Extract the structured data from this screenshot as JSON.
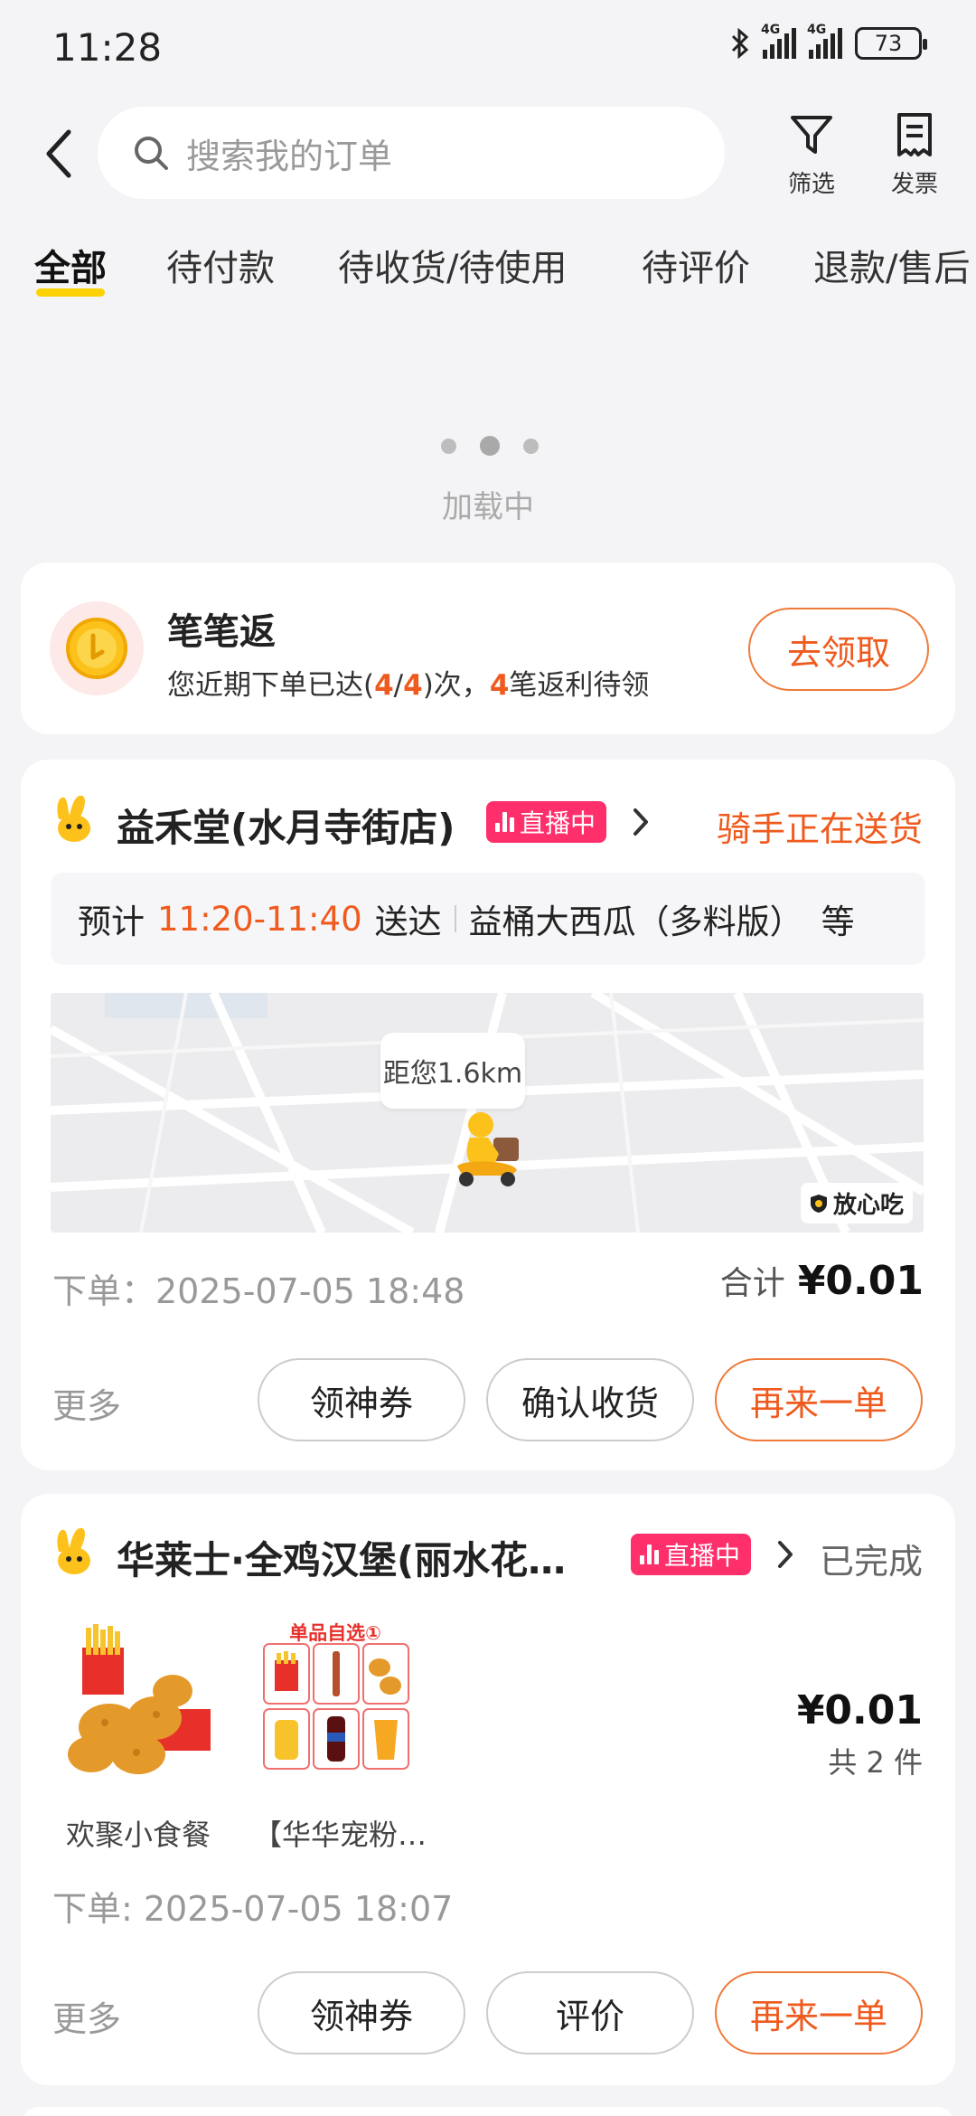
{
  "status_bar": {
    "time": "11:28",
    "battery": "73",
    "net1": "4G",
    "net2": "4G"
  },
  "header": {
    "search_placeholder": "搜索我的订单",
    "filter_label": "筛选",
    "invoice_label": "发票"
  },
  "tabs": [
    {
      "label": "全部",
      "active": true
    },
    {
      "label": "待付款"
    },
    {
      "label": "待收货/待使用"
    },
    {
      "label": "待评价"
    },
    {
      "label": "退款/售后"
    }
  ],
  "loading": {
    "text": "加载中"
  },
  "rebate": {
    "title": "笔笔返",
    "desc_pre": "您近期下单已达(",
    "count_done": "4",
    "slash": "/",
    "count_total": "4",
    "desc_mid": ")次，",
    "count_pending": "4",
    "desc_post": "笔返利待领",
    "button": "去领取"
  },
  "orders": [
    {
      "store": "益禾堂(水月寺街店)",
      "live_badge": "直播中",
      "status": "骑手正在送货",
      "eta_prefix": "预计",
      "eta_time": "11:20-11:40",
      "eta_suffix": "送达",
      "items_summary": "益桶大西瓜（多料版）",
      "items_more": "等",
      "distance": "距您1.6km",
      "trust_badge": "放心吃",
      "order_time": "下单：2025-07-05 18:48",
      "total_label": "合计",
      "total": "¥0.01",
      "more": "更多",
      "buttons": [
        "领神券",
        "确认收货",
        "再来一单"
      ]
    },
    {
      "store": "华莱士·全鸡汉堡(丽水花…",
      "live_badge": "直播中",
      "status": "已完成",
      "items": [
        {
          "name": "欢聚小食餐"
        },
        {
          "name": "【华华宠粉…",
          "overlay": "单品自选①"
        }
      ],
      "price": "¥0.01",
      "count": "共 2 件",
      "order_time": "下单: 2025-07-05 18:07",
      "more": "更多",
      "buttons": [
        "领神券",
        "评价",
        "再来一单"
      ]
    }
  ],
  "colors": {
    "accent_orange": "#ef5a1e",
    "live_pink": "#ff2f6b",
    "tab_underline": "#fcd200",
    "background": "#f4f4f6"
  }
}
